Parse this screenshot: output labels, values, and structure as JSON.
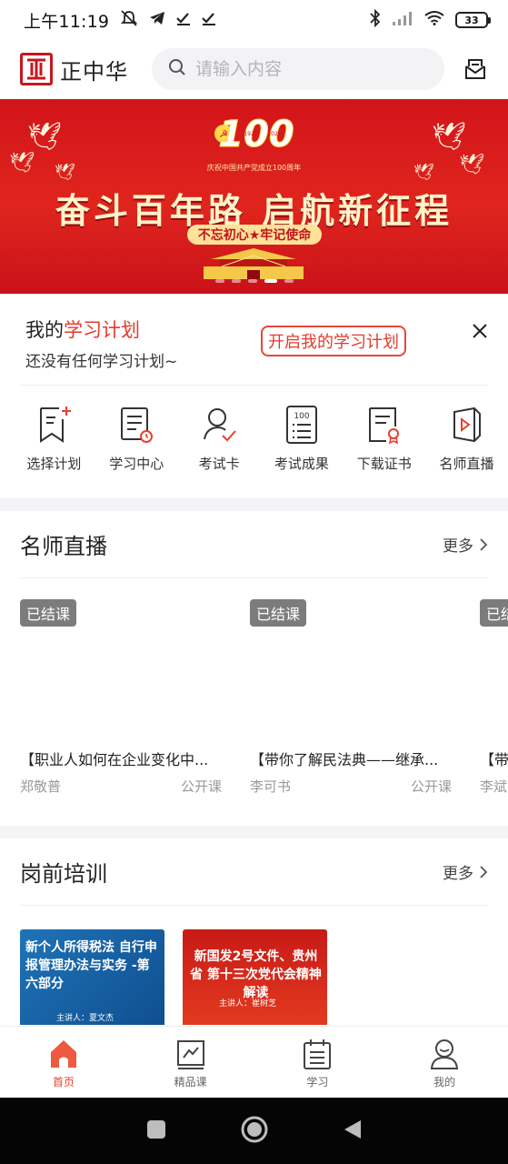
{
  "status_bar": {
    "time": "上午11:19",
    "battery": "33"
  },
  "header": {
    "logo_text": "正中华",
    "search_placeholder": "请输入内容"
  },
  "banner": {
    "headline": "奋斗百年路 启航新征程",
    "slogan": "不忘初心★牢记使命",
    "caption": "庆祝中国共产党成立100周年",
    "badge_number": "100",
    "year_left": "1921",
    "year_right": "2021",
    "slide_count": 5,
    "active_slide": 4,
    "colors": {
      "red": "#d2141a",
      "gold": "#ffe29a"
    }
  },
  "study_plan": {
    "title_prefix": "我的",
    "title_highlight": "学习计划",
    "empty_text": "还没有任何学习计划~",
    "start_button": "开启我的学习计划"
  },
  "features": [
    {
      "label": "选择计划",
      "icon": "bookmark-add-icon"
    },
    {
      "label": "学习中心",
      "icon": "list-clock-icon"
    },
    {
      "label": "考试卡",
      "icon": "user-check-icon"
    },
    {
      "label": "考试成果",
      "icon": "score-sheet-icon"
    },
    {
      "label": "下载证书",
      "icon": "certificate-icon"
    },
    {
      "label": "名师直播",
      "icon": "video-play-icon"
    }
  ],
  "live_section": {
    "title": "名师直播",
    "more": "更多",
    "cards": [
      {
        "tag": "已结课",
        "title": "【职业人如何在企业变化中...",
        "teacher": "郑敬普",
        "type": "公开课"
      },
      {
        "tag": "已结课",
        "title": "【带你了解民法典——继承...",
        "teacher": "李可书",
        "type": "公开课"
      },
      {
        "tag": "已结课",
        "title": "【带",
        "teacher": "李斌",
        "type": ""
      }
    ]
  },
  "training_section": {
    "title": "岗前培训",
    "more": "更多",
    "cards": [
      {
        "title": "新个人所得税法 自行申报管理办法与实务 -第六部分",
        "speaker": "主讲人：夏文杰",
        "bg": "#1f73b8",
        "fg": "#ffffff"
      },
      {
        "title": "新国发2号文件、贵州省 第十三次党代会精神解读",
        "speaker": "主讲人：崔树芝",
        "bg": "#d4231d",
        "fg": "#ffffff"
      }
    ]
  },
  "tabbar": [
    {
      "label": "首页",
      "icon": "home-icon",
      "active": true
    },
    {
      "label": "精品课",
      "icon": "chart-board-icon",
      "active": false
    },
    {
      "label": "学习",
      "icon": "calendar-list-icon",
      "active": false
    },
    {
      "label": "我的",
      "icon": "profile-icon",
      "active": false
    }
  ],
  "accent_color": "#e8402f"
}
